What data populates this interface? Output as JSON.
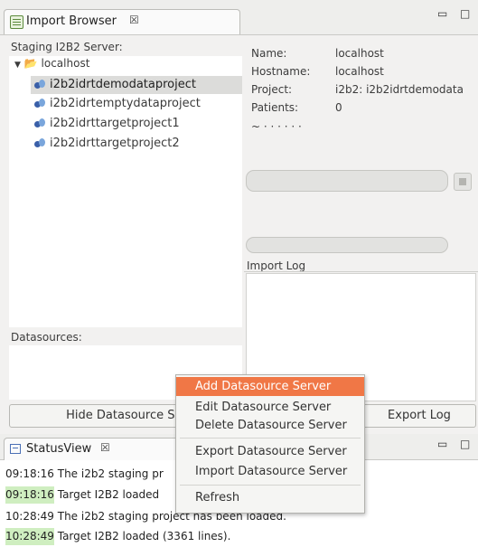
{
  "import_browser": {
    "tab_title": "Import Browser",
    "close_glyph": "☒",
    "minimize_glyph": "▭",
    "maximize_glyph": "□",
    "staging_label": "Staging I2B2 Server:",
    "server_node": "localhost",
    "projects": [
      "i2b2idrtdemodataproject",
      "i2b2idrtemptydataproject",
      "i2b2idrttargetproject1",
      "i2b2idrttargetproject2"
    ],
    "selected_project_index": 0,
    "details": {
      "name_label": "Name:",
      "name_value": "localhost",
      "hostname_label": "Hostname:",
      "hostname_value": "localhost",
      "project_label": "Project:",
      "project_value": "i2b2: i2b2idrtdemodata",
      "patients_label": "Patients:",
      "patients_value": "0"
    },
    "import_log_label": "Import Log",
    "datasources_label": "Datasources:",
    "hide_button": "Hide Datasource Ser",
    "export_log_button": "Export Log"
  },
  "context_menu": {
    "items": [
      "Add Datasource Server",
      "Edit Datasource Server",
      "Delete Datasource Server",
      "Export Datasource Server",
      "Import Datasource Server",
      "Refresh"
    ],
    "selected_index": 0
  },
  "status_view": {
    "tab_title": "StatusView",
    "close_glyph": "☒",
    "lines": [
      {
        "time": "09:18:16",
        "text": "The i2b2 staging pr",
        "highlight": false
      },
      {
        "time": "09:18:16",
        "text": "Target I2B2 loaded",
        "highlight": true
      },
      {
        "time": "10:28:49",
        "text": "The i2b2 staging project has been loaded.",
        "highlight": false
      },
      {
        "time": "10:28:49",
        "text": "Target I2B2 loaded (3361 lines).",
        "highlight": true
      }
    ]
  },
  "colors": {
    "menu_highlight": "#f07746",
    "log_highlight": "#cfeec0"
  }
}
